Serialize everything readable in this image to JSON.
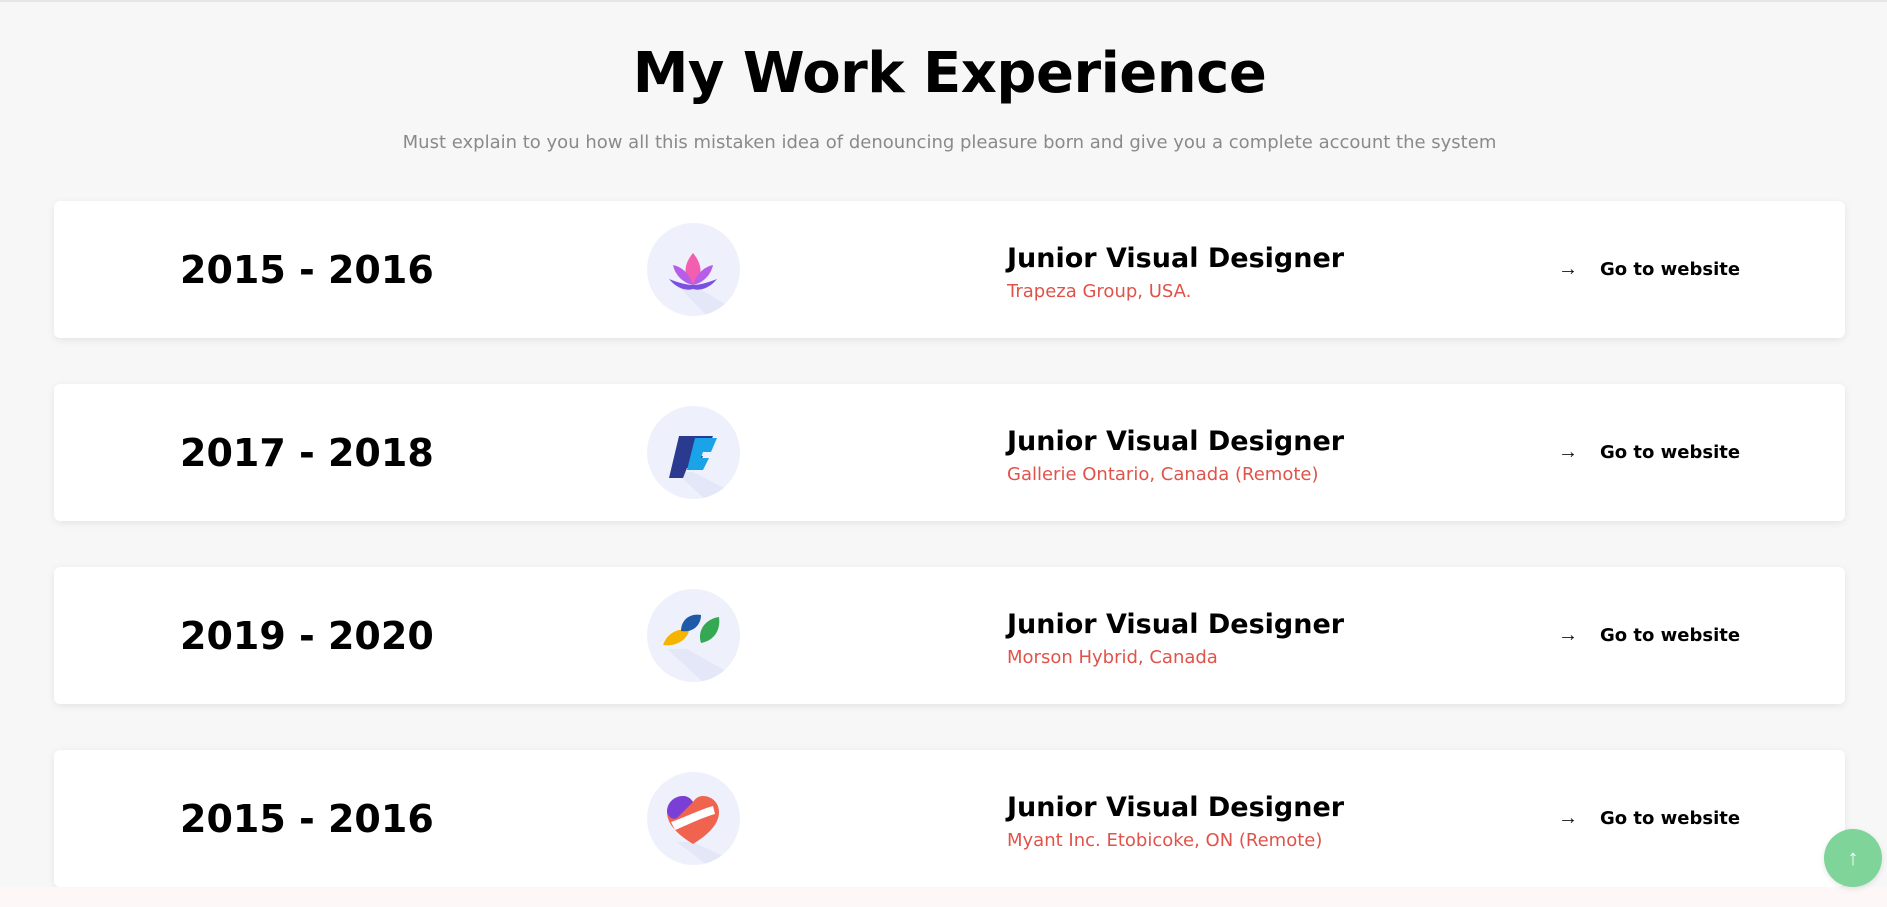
{
  "header": {
    "title": "My Work Experience",
    "subtitle": "Must explain to you how all this mistaken idea of denouncing pleasure born and give you a complete account the system"
  },
  "experiences": [
    {
      "years": "2015 - 2016",
      "role": "Junior Visual Designer",
      "company": "Trapeza Group, USA.",
      "link_label": "Go to website",
      "logo_icon": "lotus-logo-icon"
    },
    {
      "years": "2017 - 2018",
      "role": "Junior Visual Designer",
      "company": "Gallerie Ontario, Canada (Remote)",
      "link_label": "Go to website",
      "logo_icon": "f-letter-logo-icon"
    },
    {
      "years": "2019 - 2020",
      "role": "Junior Visual Designer",
      "company": "Morson Hybrid, Canada",
      "link_label": "Go to website",
      "logo_icon": "leaves-logo-icon"
    },
    {
      "years": "2015 - 2016",
      "role": "Junior Visual Designer",
      "company": "Myant Inc. Etobicoke, ON (Remote)",
      "link_label": "Go to website",
      "logo_icon": "heart-logo-icon"
    }
  ],
  "icons": {
    "arrow": "arrow-right-icon",
    "back_to_top": "arrow-up-icon"
  },
  "colors": {
    "company_text": "#e0534a",
    "back_to_top_bg": "#7fd49a",
    "page_bg": "#f7f7f7"
  }
}
